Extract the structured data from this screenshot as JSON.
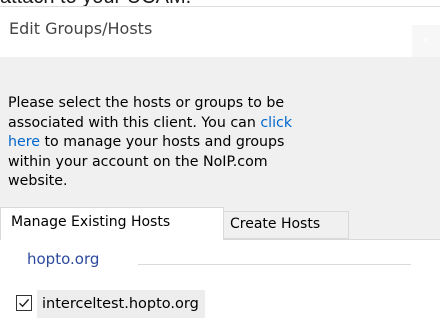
{
  "cropped_text": "attach to your UCAM.",
  "window": {
    "title": "Edit Groups/Hosts",
    "close_glyph": "x"
  },
  "message": {
    "before_link": "Please select the hosts or groups to be associated with this client. You can ",
    "link_text": "click here",
    "after_link": " to manage your hosts and groups within your account on the NoIP.com website."
  },
  "tabs": [
    {
      "label": "Manage Existing Hosts",
      "active": true
    },
    {
      "label": "Create Hosts",
      "active": false
    }
  ],
  "groups": [
    {
      "name": "hopto.org",
      "hosts": [
        {
          "name": "interceltest.hopto.org",
          "checked": true
        }
      ]
    }
  ],
  "icons": {
    "checkbox_check": "checkmark-icon"
  },
  "colors": {
    "link": "#0066cc",
    "group_label": "#2b4a9c",
    "window_bg": "#f0f0f0"
  }
}
